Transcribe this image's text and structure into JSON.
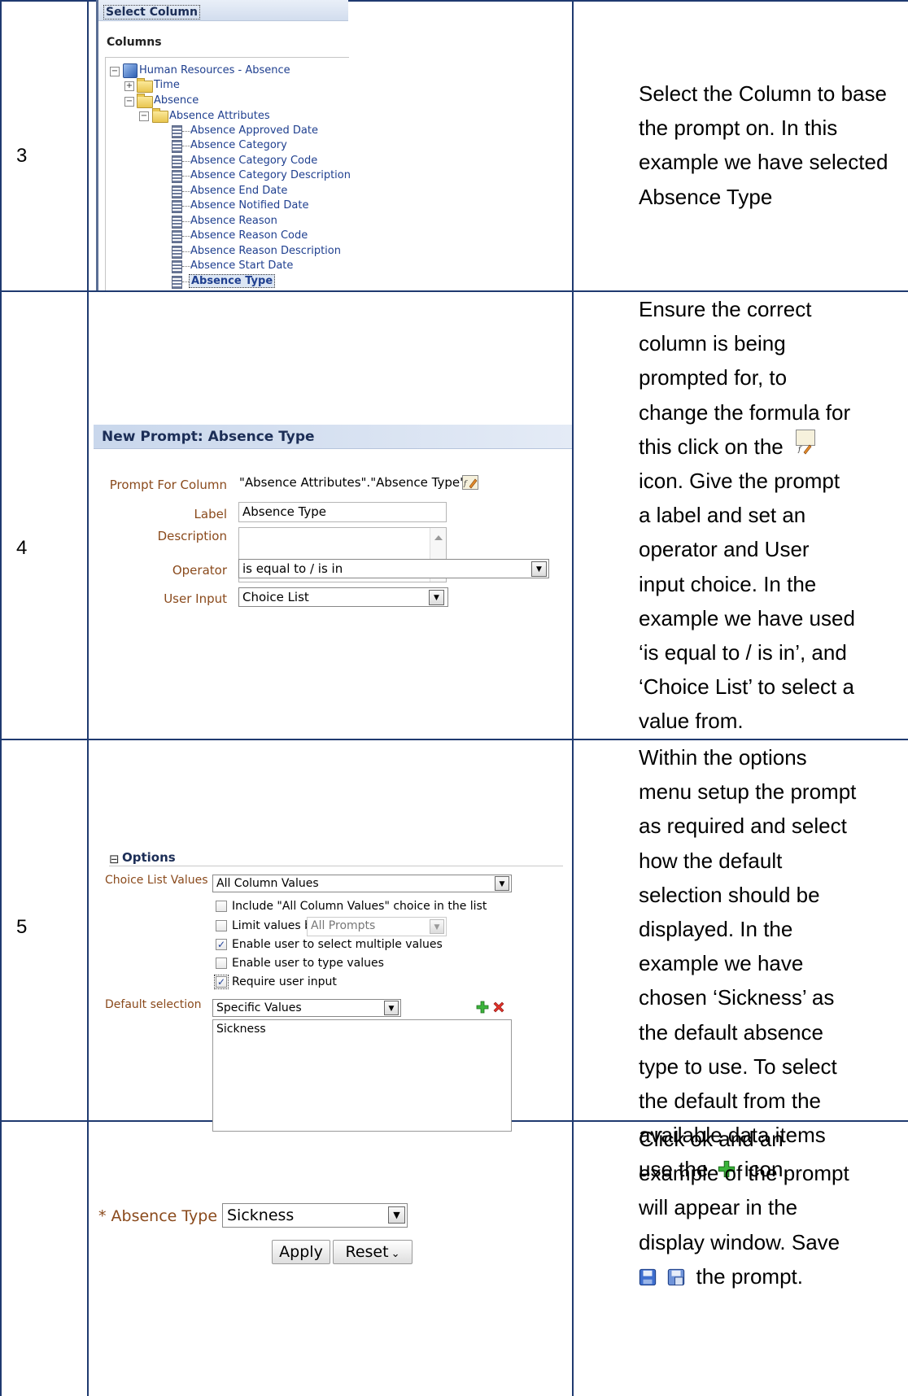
{
  "rows": [
    {
      "step": "3",
      "description": "Select the Column to base the prompt on.  In this example we have selected Absence Type",
      "select_column": {
        "header": "Select Column",
        "columns_title": "Columns",
        "subject_area": "Human Resources - Absence",
        "folders": [
          "Time",
          "Absence",
          "Absence Attributes"
        ],
        "items": [
          "Absence Approved Date",
          "Absence Category",
          "Absence Category Code",
          "Absence Category Description",
          "Absence End Date",
          "Absence Notified Date",
          "Absence Reason",
          "Absence Reason Code",
          "Absence Reason Description",
          "Absence Start Date",
          "Absence Type"
        ],
        "selected_item": "Absence Type"
      }
    },
    {
      "step": "4",
      "description_lines": [
        "Ensure the correct",
        "column is being",
        "prompted for, to",
        "change the formula for",
        "this click on the",
        "icon.  Give the prompt",
        "a label and set an",
        "operator and User",
        "input choice.  In the",
        "example we have used",
        "‘is equal to / is in’, and",
        "‘Choice List’ to select a",
        "value from."
      ],
      "new_prompt": {
        "title": "New Prompt: Absence Type",
        "prompt_for_column_label": "Prompt For Column",
        "prompt_for_column_value": "\"Absence Attributes\".\"Absence Type\"",
        "label_label": "Label",
        "label_value": "Absence Type",
        "description_label": "Description",
        "description_value": "",
        "operator_label": "Operator",
        "operator_value": "is equal to / is in",
        "user_input_label": "User Input",
        "user_input_value": "Choice List"
      }
    },
    {
      "step": "5",
      "description_lines": [
        "Within the options",
        "menu setup the prompt",
        "as required and select",
        "how the default",
        "selection should be",
        "displayed.  In the",
        "example we have",
        "chosen ‘Sickness’ as",
        "the default absence",
        "type to use.  To select",
        "the default from the",
        "available data items",
        "use the",
        "icon."
      ],
      "options": {
        "title": "Options",
        "choice_list_values_label": "Choice List Values",
        "choice_list_values_value": "All Column Values",
        "include_all_label": "Include \"All Column Values\" choice in the list",
        "include_all_checked": false,
        "limit_values_label": "Limit values by",
        "limit_values_value": "All Prompts",
        "limit_values_checked": false,
        "multiple_values_label": "Enable user to select multiple values",
        "multiple_values_checked": true,
        "type_values_label": "Enable user to type values",
        "type_values_checked": false,
        "require_input_label": "Require user input",
        "require_input_checked": true,
        "default_selection_label": "Default selection",
        "default_selection_value": "Specific Values",
        "default_values": [
          "Sickness"
        ]
      }
    },
    {
      "step": "",
      "description_lines": [
        "Click ok and an",
        "example of the prompt",
        "will appear in the",
        "display window.  Save",
        "the prompt."
      ],
      "preview": {
        "label": "* Absence Type",
        "value": "Sickness",
        "apply_label": "Apply",
        "reset_label": "Reset"
      }
    }
  ],
  "icons": {
    "formula": "edit-formula-icon",
    "add": "green-plus-icon",
    "remove": "red-x-icon",
    "save": "save-icon",
    "save_as": "save-as-icon"
  },
  "colors": {
    "border": "#1f3a70",
    "label_brown": "#8a4a1c",
    "tree_blue": "#1f3f8f",
    "panel_header": "#dde6f3"
  }
}
